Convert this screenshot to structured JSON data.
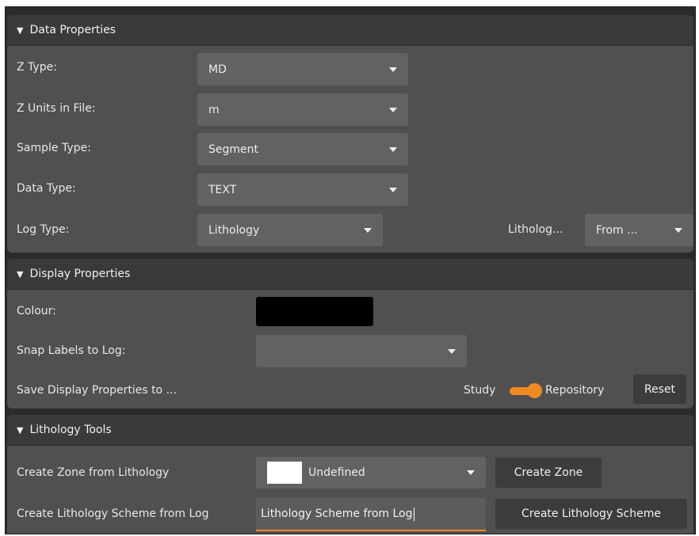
{
  "data_properties": {
    "title": "Data Properties",
    "z_type": {
      "label": "Z Type:",
      "value": "MD"
    },
    "z_units": {
      "label": "Z Units in File:",
      "value": "m"
    },
    "sample_type": {
      "label": "Sample Type:",
      "value": "Segment"
    },
    "data_type": {
      "label": "Data Type:",
      "value": "TEXT"
    },
    "log_type": {
      "label": "Log Type:",
      "value": "Lithology"
    },
    "lithology": {
      "label": "Litholog...",
      "value": "From ..."
    }
  },
  "display_properties": {
    "title": "Display Properties",
    "colour": {
      "label": "Colour:",
      "value_color": "#000000"
    },
    "snap_labels": {
      "label": "Snap Labels to Log:",
      "value": ""
    },
    "save_display": {
      "label": "Save Display Properties to ...",
      "left_option": "Study",
      "right_option": "Repository",
      "toggle_on": true
    },
    "reset_label": "Reset"
  },
  "lithology_tools": {
    "title": "Lithology Tools",
    "create_zone": {
      "label": "Create Zone from Lithology",
      "value": "Undefined",
      "swatch_color": "#ffffff",
      "button": "Create Zone"
    },
    "create_scheme": {
      "label": "Create Lithology Scheme from Log",
      "input_value": "Lithology Scheme from Log",
      "button": "Create Lithology Scheme"
    }
  },
  "colors": {
    "accent": "#f08a24",
    "panel": "#505050",
    "header": "#3a3a3a",
    "field": "#626262"
  }
}
